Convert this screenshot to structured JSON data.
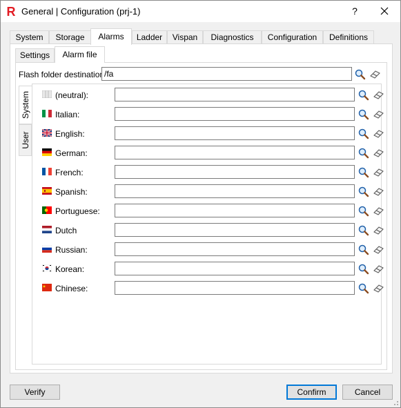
{
  "window": {
    "title": "General | Configuration (prj-1)",
    "help_label": "?",
    "logo_letter": "R"
  },
  "main_tabs": [
    {
      "label": "System"
    },
    {
      "label": "Storage"
    },
    {
      "label": "Alarms",
      "active": true
    },
    {
      "label": "Ladder"
    },
    {
      "label": "Vispan"
    },
    {
      "label": "Diagnostics"
    },
    {
      "label": "Configuration"
    },
    {
      "label": "Definitions"
    }
  ],
  "sub_tabs": [
    {
      "label": "Settings"
    },
    {
      "label": "Alarm file",
      "active": true
    }
  ],
  "flash": {
    "label": "Flash folder destination:",
    "value": "/fa"
  },
  "side_tabs": [
    {
      "label": "System",
      "active": true
    },
    {
      "label": "User"
    }
  ],
  "languages": [
    {
      "label": "(neutral):",
      "flag": "neutral-flag",
      "value": ""
    },
    {
      "label": "Italian:",
      "flag": "italy-flag",
      "value": ""
    },
    {
      "label": "English:",
      "flag": "uk-flag",
      "value": ""
    },
    {
      "label": "German:",
      "flag": "germany-flag",
      "value": ""
    },
    {
      "label": "French:",
      "flag": "france-flag",
      "value": ""
    },
    {
      "label": "Spanish:",
      "flag": "spain-flag",
      "value": ""
    },
    {
      "label": "Portuguese:",
      "flag": "portugal-flag",
      "value": ""
    },
    {
      "label": "Dutch",
      "flag": "netherlands-flag",
      "value": ""
    },
    {
      "label": "Russian:",
      "flag": "russia-flag",
      "value": ""
    },
    {
      "label": "Korean:",
      "flag": "korea-flag",
      "value": ""
    },
    {
      "label": "Chinese:",
      "flag": "china-flag",
      "value": ""
    }
  ],
  "buttons": {
    "verify": "Verify",
    "confirm": "Confirm",
    "cancel": "Cancel"
  },
  "colors": {
    "accent": "#0078d7",
    "logo_red": "#e31b23"
  }
}
